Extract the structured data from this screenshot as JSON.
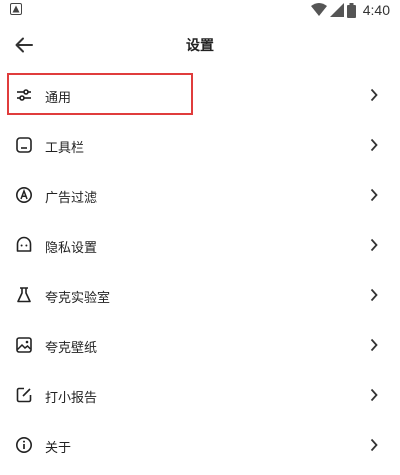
{
  "status_bar": {
    "time": "4:40"
  },
  "app_bar": {
    "title": "设置"
  },
  "menu": [
    {
      "label": "通用",
      "icon": "sliders-icon"
    },
    {
      "label": "工具栏",
      "icon": "toolbar-icon"
    },
    {
      "label": "广告过滤",
      "icon": "ad-filter-icon"
    },
    {
      "label": "隐私设置",
      "icon": "privacy-icon"
    },
    {
      "label": "夸克实验室",
      "icon": "flask-icon"
    },
    {
      "label": "夸克壁纸",
      "icon": "wallpaper-icon"
    },
    {
      "label": "打小报告",
      "icon": "feedback-icon"
    },
    {
      "label": "关于",
      "icon": "info-icon"
    }
  ],
  "colors": {
    "highlight": "#e03c3c",
    "text": "#222222"
  }
}
